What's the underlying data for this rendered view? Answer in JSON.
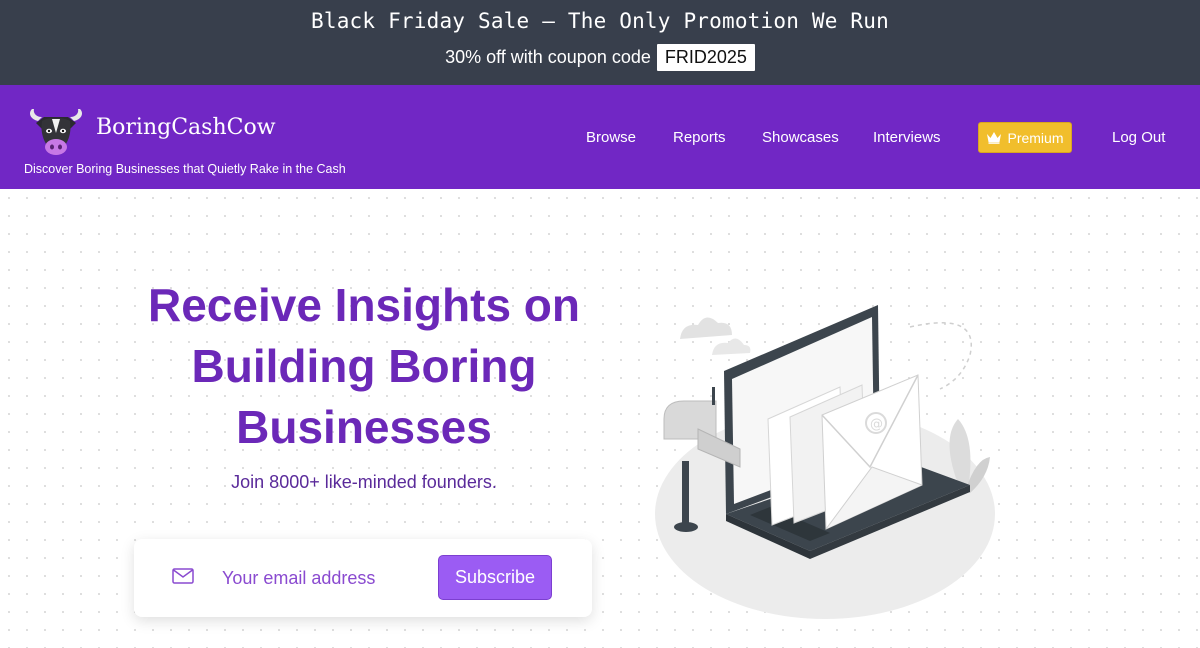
{
  "promo": {
    "title": "Black Friday Sale — The Only Promotion We Run",
    "subtitle": "30% off with coupon code",
    "coupon_code": "FRID2025"
  },
  "navbar": {
    "brand": "BoringCashCow",
    "tagline": "Discover Boring Businesses that Quietly Rake in the Cash",
    "links": [
      "Browse",
      "Reports",
      "Showcases",
      "Interviews"
    ],
    "premium_label": "Premium",
    "premium_icon": "crown-icon",
    "logout_label": "Log Out"
  },
  "hero": {
    "headline": "Receive Insights on Building Boring Businesses",
    "subheadline": "Join 8000+ like-minded founders.",
    "email_placeholder": "Your email address",
    "email_icon": "envelope-icon",
    "subscribe_label": "Subscribe"
  },
  "colors": {
    "banner": "#383f4c",
    "brand_purple": "#7127c5",
    "headline_purple": "#6b28b8",
    "button_purple": "#9b5cf3",
    "premium_gold": "#f1be2c"
  }
}
